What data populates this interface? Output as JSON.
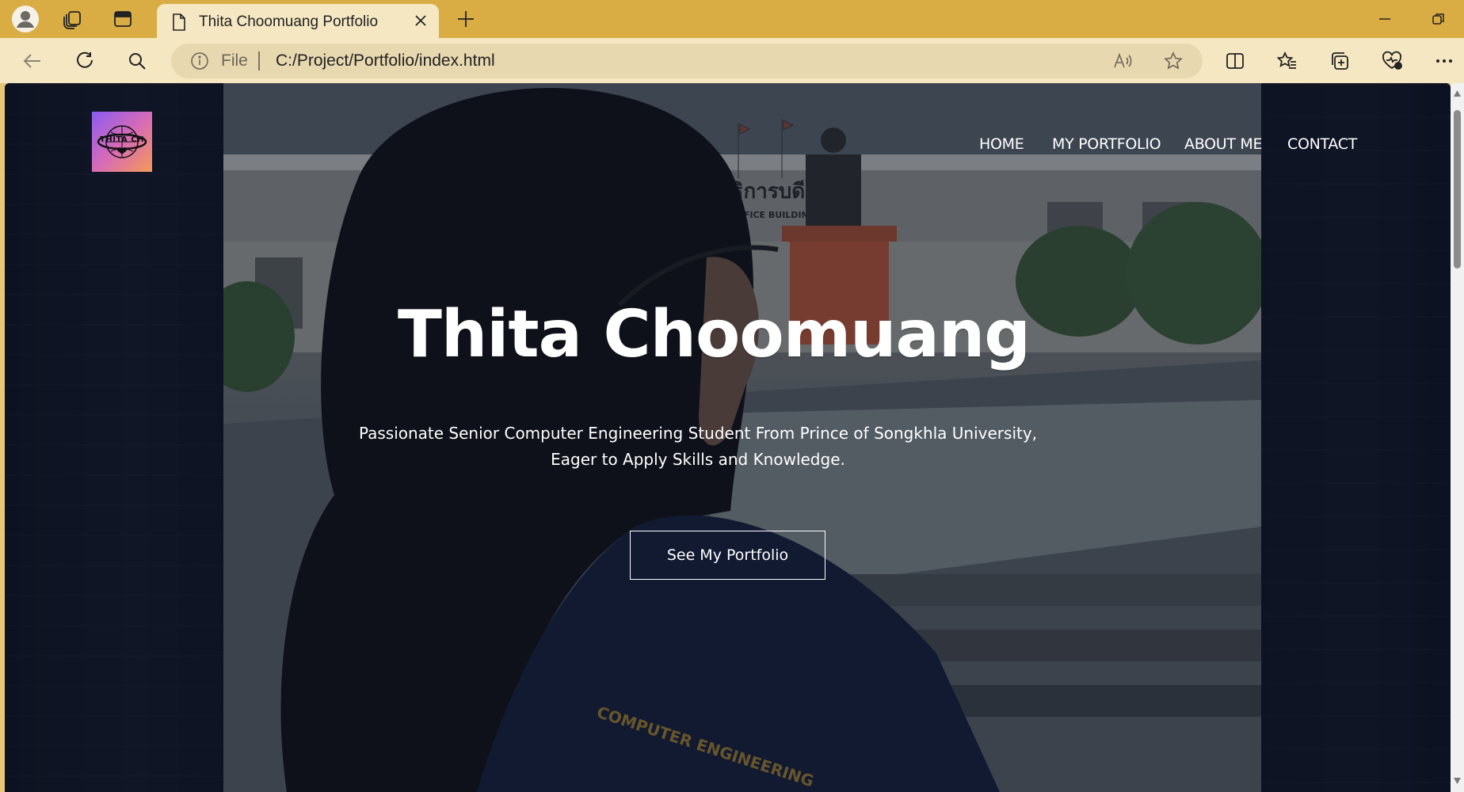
{
  "browser": {
    "tab": {
      "title": "Thita Choomuang Portfolio"
    },
    "address": {
      "scheme_label": "File",
      "url": "C:/Project/Portfolio/index.html"
    },
    "colors": {
      "frame": "#d9ad43",
      "toolbar": "#f5e7c2"
    }
  },
  "site": {
    "logo_text": "THITA CH",
    "nav": [
      {
        "label": "HOME"
      },
      {
        "label": "MY PORTFOLIO"
      },
      {
        "label": "ABOUT ME"
      },
      {
        "label": "CONTACT"
      }
    ],
    "hero": {
      "title": "Thita Choomuang",
      "subtitle_line1": "Passionate Senior Computer Engineering Student From Prince of Songkhla University,",
      "subtitle_line2": "Eager to Apply Skills and Knowledge.",
      "button": "See My Portfolio"
    },
    "background_text": {
      "thai_sign": "อธิการบดี",
      "building_sign": "OFFICE BUILDING",
      "shirt_text": "COMPUTER ENGINEERING"
    }
  }
}
